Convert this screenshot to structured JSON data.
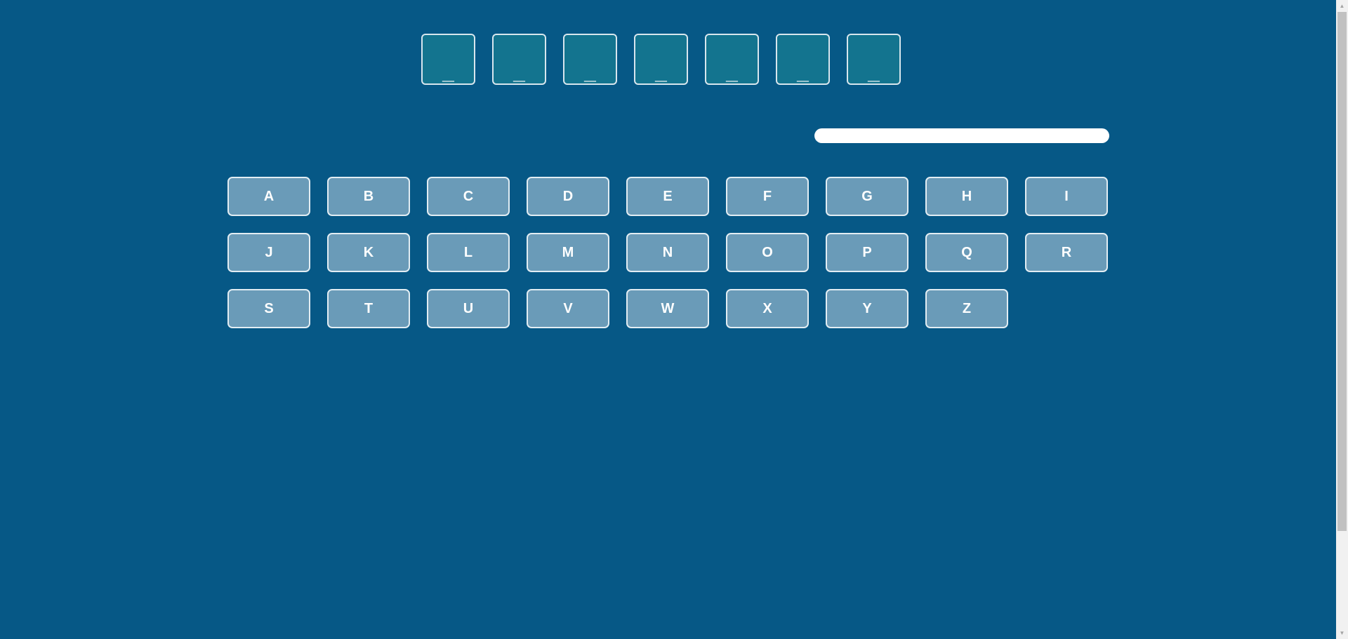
{
  "word": {
    "slots": [
      "_",
      "_",
      "_",
      "_",
      "_",
      "_",
      "_"
    ]
  },
  "progress": {
    "fraction": 1.0
  },
  "keyboard": {
    "letters": [
      "A",
      "B",
      "C",
      "D",
      "E",
      "F",
      "G",
      "H",
      "I",
      "J",
      "K",
      "L",
      "M",
      "N",
      "O",
      "P",
      "Q",
      "R",
      "S",
      "T",
      "U",
      "V",
      "W",
      "X",
      "Y",
      "Z"
    ]
  },
  "colors": {
    "background": "#065886",
    "slot_fill": "#13748f",
    "key_fill": "#6a9bb8",
    "border": "#e2edf3",
    "progress_bar": "#ffffff"
  },
  "icons": {
    "scroll_up": "triangle-up-icon",
    "scroll_down": "triangle-down-icon"
  }
}
